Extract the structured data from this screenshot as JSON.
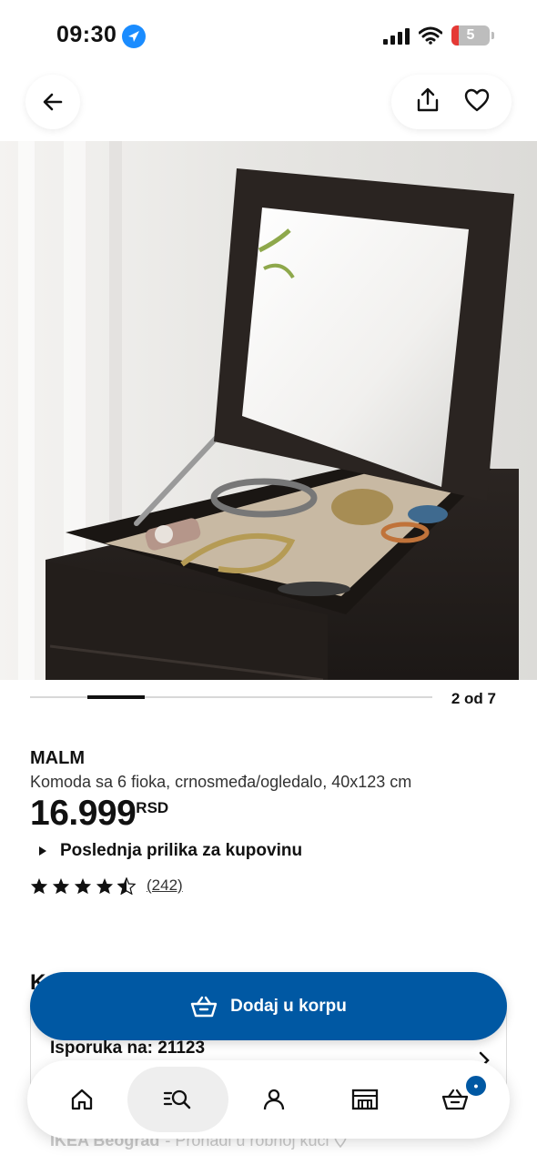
{
  "status_bar": {
    "time": "09:30",
    "battery": "5"
  },
  "header": {
    "back_icon": "arrow-left-icon",
    "share_icon": "share-icon",
    "favorite_icon": "heart-icon"
  },
  "gallery": {
    "counter": "2 od 7",
    "current": 2,
    "total": 7
  },
  "product": {
    "brand": "MALM",
    "description": "Komoda sa 6 fioka, crnosmeđa/ogledalo, 40x123 cm",
    "price": "16.999",
    "currency": "RSD",
    "availability": "Poslednja prilika za kupovinu",
    "rating": 4.5,
    "rating_max": 5,
    "review_count": "(242)"
  },
  "section_peek": "K",
  "delivery": {
    "label": "Isporuka na: 21123",
    "store_name": "IKEA Beograd",
    "store_hint": "- Pronađi u robnoj kući"
  },
  "cart_button": {
    "label": "Dodaj u korpu",
    "icon": "basket-icon"
  },
  "bottom_nav": {
    "items": [
      "home-icon",
      "search-list-icon",
      "person-icon",
      "store-icon",
      "basket-icon"
    ],
    "active": "search-list-icon",
    "cart_badge": "•"
  },
  "colors": {
    "accent": "#0058a3",
    "text": "#111111"
  }
}
